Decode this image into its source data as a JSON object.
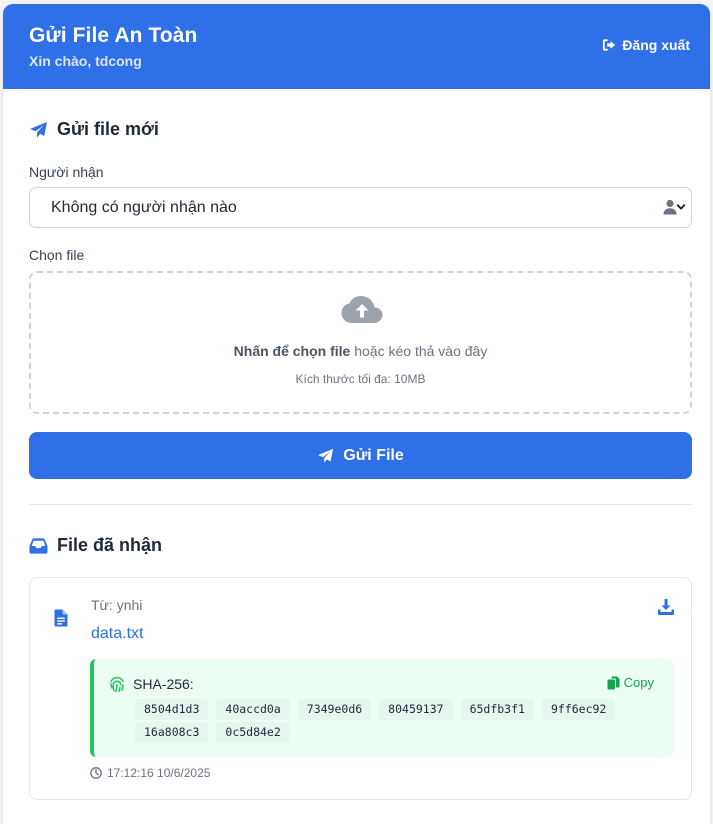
{
  "header": {
    "title": "Gửi File An Toàn",
    "greeting": "Xin chào, tdcong",
    "logout_label": "Đăng xuất"
  },
  "send_section": {
    "title": "Gửi file mới",
    "recipient_label": "Người nhận",
    "recipient_value": "Không có người nhận nào",
    "file_label": "Chọn file",
    "drop_strong": "Nhấn để chọn file",
    "drop_rest": " hoặc kéo thả vào đây",
    "drop_hint": "Kích thước tối đa: 10MB",
    "send_button": "Gửi File"
  },
  "received_section": {
    "title": "File đã nhận",
    "files": [
      {
        "from": "Từ: ynhi",
        "name": "data.txt",
        "hash_label": "SHA-256:",
        "copy_label": "Copy",
        "hash_chunks": [
          "8504d1d3",
          "40accd0a",
          "7349e0d6",
          "80459137",
          "65dfb3f1",
          "9ff6ec92",
          "16a808c3",
          "0c5d84e2"
        ],
        "time": "17:12:16 10/6/2025"
      }
    ]
  },
  "colors": {
    "primary": "#2f6fe8",
    "success": "#22c55e",
    "hash_bg": "#ecfdf3"
  },
  "icons": {
    "logout": "logout-icon",
    "send": "paper-plane-icon",
    "user": "user-icon",
    "upload": "cloud-upload-icon",
    "inbox": "inbox-icon",
    "file": "file-icon",
    "download": "download-icon",
    "fingerprint": "fingerprint-icon",
    "copy": "copy-icon",
    "clock": "clock-icon"
  }
}
